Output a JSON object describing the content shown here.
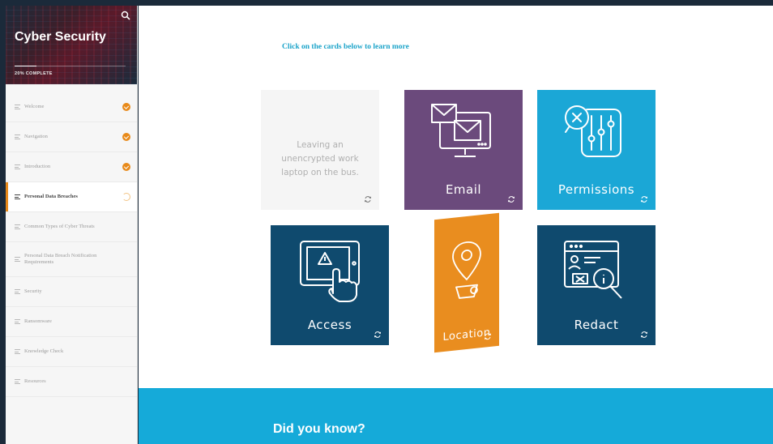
{
  "sidebar": {
    "course_title": "Cyber Security",
    "progress_text": "20% COMPLETE",
    "progress_value": 0.2,
    "items": [
      {
        "label": "Welcome",
        "status": "complete"
      },
      {
        "label": "Navigation",
        "status": "complete"
      },
      {
        "label": "Introduction",
        "status": "complete"
      },
      {
        "label": "Personal Data Breaches",
        "status": "in-progress"
      },
      {
        "label": "Common Types of Cyber Threats",
        "status": "none"
      },
      {
        "label": "Personal Data Breach Notification Requirements",
        "status": "none"
      },
      {
        "label": "Security",
        "status": "none"
      },
      {
        "label": "Ransomware",
        "status": "none"
      },
      {
        "label": "Knowledge Check",
        "status": "none"
      },
      {
        "label": "Resources",
        "status": "none"
      }
    ]
  },
  "main": {
    "instruction": "Click on the cards below to learn more",
    "cards": {
      "back_text": "Leaving an unencrypted work laptop on the bus.",
      "email": "Email",
      "permissions": "Permissions",
      "access": "Access",
      "location": "Location",
      "redact": "Redact"
    },
    "did_you_know": "Did you know?"
  },
  "colors": {
    "accent": "#e88a1a",
    "email_card": "#6b4a7c",
    "permissions_card": "#1ba7d6",
    "dark_card": "#0f4a6e",
    "location_card": "#e98d1f",
    "banner": "#15aad9"
  },
  "icons": {
    "search": "search-icon",
    "flip": "flip-icon",
    "check": "check-icon"
  }
}
